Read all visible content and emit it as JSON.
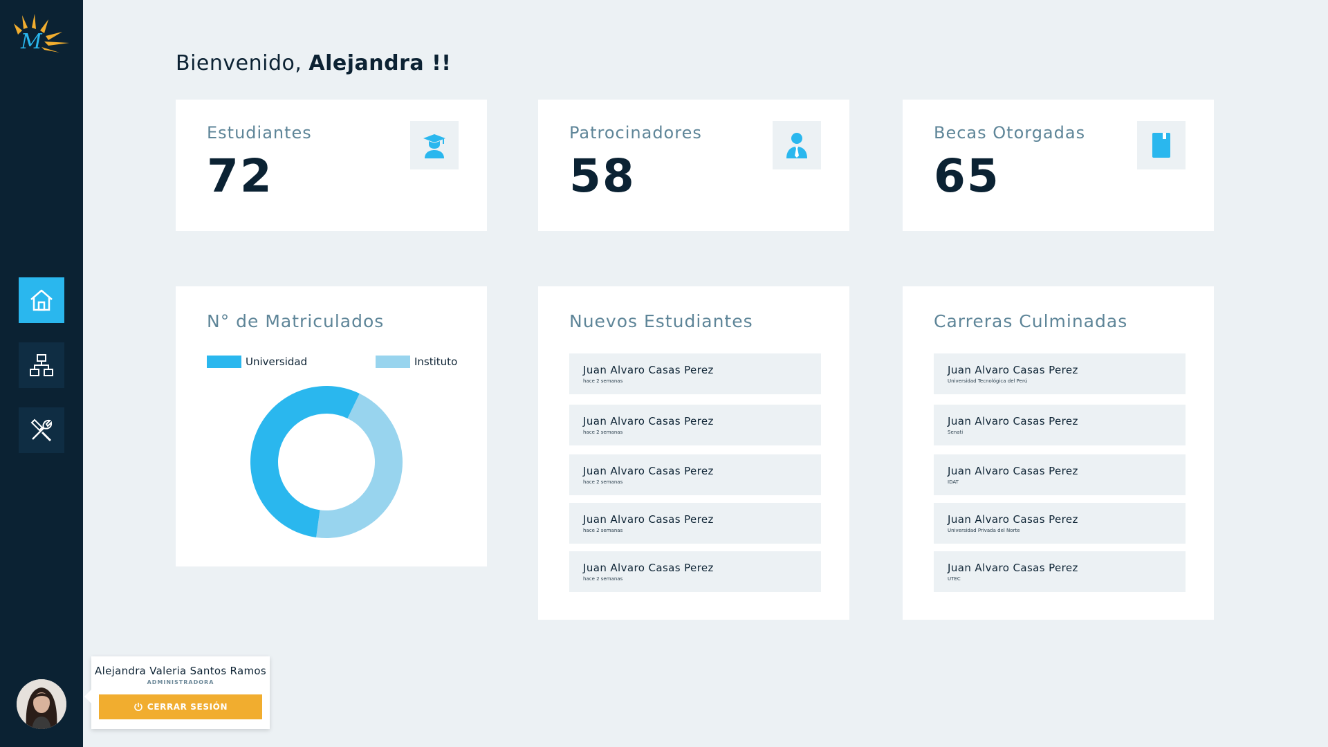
{
  "sidebar": {
    "nav": [
      {
        "icon": "home-icon",
        "active": true
      },
      {
        "icon": "org-chart-icon",
        "active": false
      },
      {
        "icon": "tools-icon",
        "active": false
      }
    ]
  },
  "greeting": {
    "prefix": "Bienvenido, ",
    "name": "Alejandra !!"
  },
  "stats": [
    {
      "label": "Estudiantes",
      "value": "72",
      "icon": "graduate-icon"
    },
    {
      "label": "Patrocinadores",
      "value": "58",
      "icon": "sponsor-icon"
    },
    {
      "label": "Becas Otorgadas",
      "value": "65",
      "icon": "book-icon"
    }
  ],
  "enrolled": {
    "title": "N° de Matriculados",
    "legend": [
      {
        "label": "Universidad",
        "color": "#2ab7ee"
      },
      {
        "label": "Instituto",
        "color": "#98d4ee"
      }
    ]
  },
  "chart_data": {
    "type": "pie",
    "donut": true,
    "title": "N° de Matriculados",
    "categories": [
      "Universidad",
      "Instituto"
    ],
    "values": [
      55,
      45
    ],
    "colors": [
      "#2ab7ee",
      "#98d4ee"
    ],
    "legend_position": "top"
  },
  "new_students": {
    "title": "Nuevos Estudiantes",
    "items": [
      {
        "name": "Juan Alvaro Casas Perez",
        "sub": "hace 2 semanas"
      },
      {
        "name": "Juan Alvaro Casas Perez",
        "sub": "hace 2 semanas"
      },
      {
        "name": "Juan Alvaro Casas Perez",
        "sub": "hace 2 semanas"
      },
      {
        "name": "Juan Alvaro Casas Perez",
        "sub": "hace 2 semanas"
      },
      {
        "name": "Juan Alvaro Casas Perez",
        "sub": "hace 2 semanas"
      }
    ]
  },
  "careers": {
    "title": "Carreras Culminadas",
    "items": [
      {
        "name": "Juan Alvaro Casas Perez",
        "sub": "Universidad Tecnológica del Perú"
      },
      {
        "name": "Juan Alvaro Casas Perez",
        "sub": "Senati"
      },
      {
        "name": "Juan Alvaro Casas Perez",
        "sub": "IDAT"
      },
      {
        "name": "Juan Alvaro Casas Perez",
        "sub": "Universidad Privada del Norte"
      },
      {
        "name": "Juan Alvaro Casas Perez",
        "sub": "UTEC"
      }
    ]
  },
  "user": {
    "name": "Alejandra Valeria Santos Ramos",
    "role": "ADMINISTRADORA",
    "logout_label": "CERRAR SESIÓN"
  },
  "colors": {
    "sidebar": "#0b2233",
    "accent": "#2ab7ee",
    "logout": "#f1ad2f",
    "background": "#ecf1f4"
  }
}
